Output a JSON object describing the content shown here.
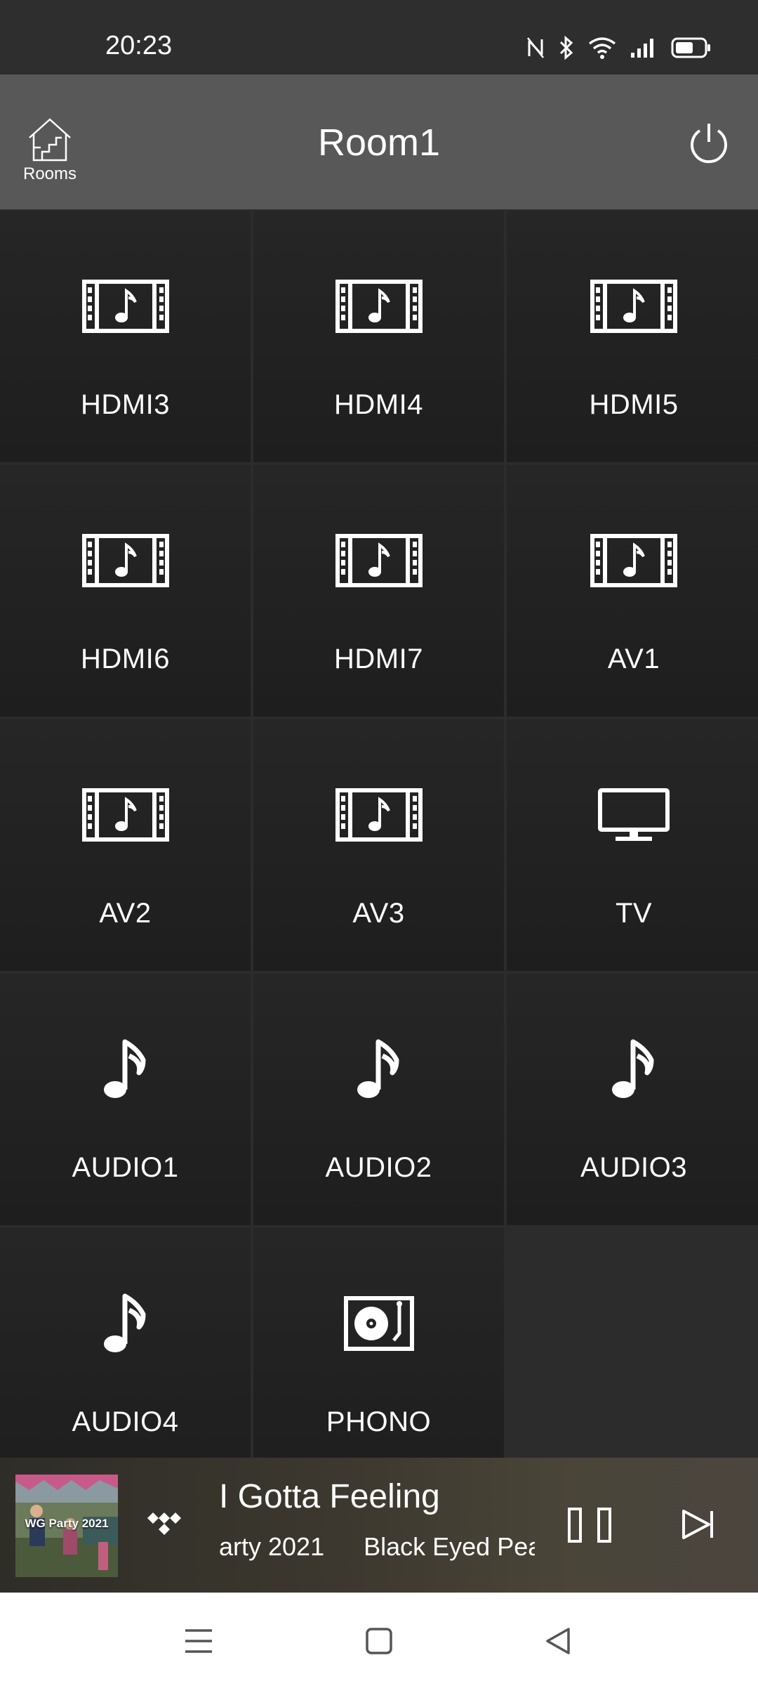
{
  "status": {
    "time": "20:23",
    "icons": [
      "nfc-off-icon",
      "bluetooth-icon",
      "wifi-icon",
      "signal-icon",
      "battery-icon"
    ]
  },
  "header": {
    "rooms_label": "Rooms",
    "title": "Room1"
  },
  "inputs": [
    {
      "label": "HDMI3",
      "icon": "video-music-icon"
    },
    {
      "label": "HDMI4",
      "icon": "video-music-icon"
    },
    {
      "label": "HDMI5",
      "icon": "video-music-icon"
    },
    {
      "label": "HDMI6",
      "icon": "video-music-icon"
    },
    {
      "label": "HDMI7",
      "icon": "video-music-icon"
    },
    {
      "label": "AV1",
      "icon": "video-music-icon"
    },
    {
      "label": "AV2",
      "icon": "video-music-icon"
    },
    {
      "label": "AV3",
      "icon": "video-music-icon"
    },
    {
      "label": "TV",
      "icon": "tv-icon"
    },
    {
      "label": "AUDIO1",
      "icon": "music-note-icon"
    },
    {
      "label": "AUDIO2",
      "icon": "music-note-icon"
    },
    {
      "label": "AUDIO3",
      "icon": "music-note-icon"
    },
    {
      "label": "AUDIO4",
      "icon": "music-note-icon"
    },
    {
      "label": "PHONO",
      "icon": "turntable-icon"
    }
  ],
  "player": {
    "album_art_text": "WG Party 2021",
    "song_title": "I Gotta Feeling",
    "album": "arty 2021",
    "artist": "Black Eyed Pea",
    "source_icon": "tidal-icon"
  },
  "colors": {
    "app_bar": "#585858",
    "tile": "#222222",
    "player_bar": "#3c382f"
  }
}
